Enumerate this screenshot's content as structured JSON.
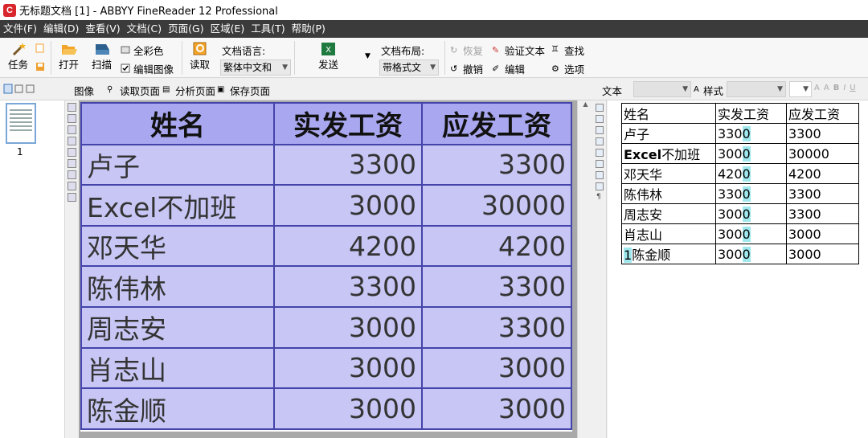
{
  "window": {
    "title": "无标题文档 [1] - ABBYY FineReader 12 Professional",
    "app_icon": "abbyy-logo-icon"
  },
  "menu": [
    "文件(F)",
    "编辑(D)",
    "查看(V)",
    "文档(C)",
    "页面(G)",
    "区域(E)",
    "工具(T)",
    "帮助(P)"
  ],
  "toolbar": {
    "task": "任务",
    "open": "打开",
    "scan": "扫描",
    "full_color": "全彩色",
    "edit_image": "编辑图像",
    "read": "读取",
    "doc_language_label": "文档语言:",
    "doc_language_value": "繁体中文和",
    "send": "发送",
    "doc_layout_label": "文档布局:",
    "doc_layout_value": "带格式文",
    "restore": "恢复",
    "undo": "撤销",
    "verify_text": "验证文本",
    "find": "查找",
    "edit": "编辑",
    "options": "选项"
  },
  "image_bar": {
    "label": "图像",
    "read_page": "读取页面",
    "analyze_page": "分析页面",
    "save_page": "保存页面"
  },
  "text_bar": {
    "label": "文本",
    "style": "样式",
    "font_buttons": [
      "A",
      "A",
      "B",
      "I",
      "U"
    ]
  },
  "thumbnail": {
    "page_number": "1"
  },
  "image_table": {
    "headers": [
      "姓名",
      "实发工资",
      "应发工资"
    ],
    "rows": [
      [
        "卢子",
        "3300",
        "3300"
      ],
      [
        "Excel不加班",
        "3000",
        "30000"
      ],
      [
        "邓天华",
        "4200",
        "4200"
      ],
      [
        "陈伟林",
        "3300",
        "3300"
      ],
      [
        "周志安",
        "3000",
        "3300"
      ],
      [
        "肖志山",
        "3000",
        "3000"
      ],
      [
        "陈金顺",
        "3000",
        "3000"
      ]
    ]
  },
  "text_table": {
    "headers": [
      "姓名",
      "实发工资",
      "应发工资"
    ],
    "rows": [
      {
        "name_bold": "",
        "name_prefix": "",
        "name": "卢子",
        "a_main": "330",
        "a_hl": "0",
        "b": "3300"
      },
      {
        "name_bold": "Excel",
        "name_prefix": "",
        "name": "不加班",
        "a_main": "300",
        "a_hl": "0",
        "b": "30000"
      },
      {
        "name_bold": "",
        "name_prefix": "",
        "name": "邓天华",
        "a_main": "420",
        "a_hl": "0",
        "b": "4200"
      },
      {
        "name_bold": "",
        "name_prefix": "",
        "name": "陈伟林",
        "a_main": "330",
        "a_hl": "0",
        "b": "3300"
      },
      {
        "name_bold": "",
        "name_prefix": "",
        "name": "周志安",
        "a_main": "300",
        "a_hl": "0",
        "b": "3300"
      },
      {
        "name_bold": "",
        "name_prefix": "",
        "name": "肖志山",
        "a_main": "300",
        "a_hl": "0",
        "b": "3000"
      },
      {
        "name_bold": "",
        "name_prefix": "1",
        "name": "陈金顺",
        "a_main": "300",
        "a_hl": "0",
        "b": "3000"
      }
    ]
  },
  "colors": {
    "menubar": "#3b3b3b",
    "selection_blue": "#c7c6f4",
    "header_blue": "#a9a7ef",
    "uncertain_highlight": "#9fe8ee"
  }
}
